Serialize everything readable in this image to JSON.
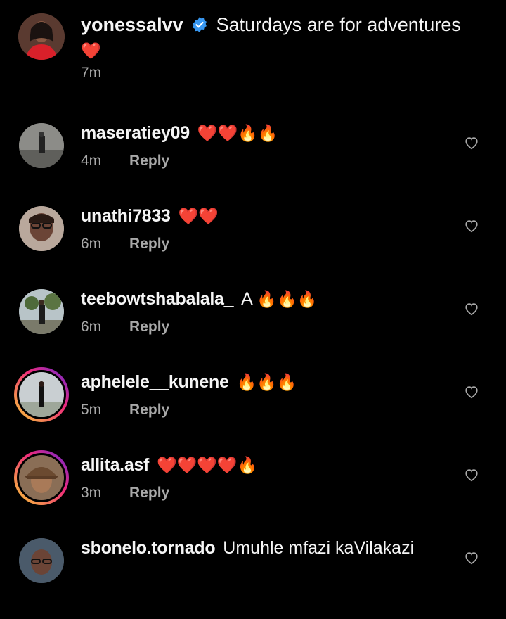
{
  "caption": {
    "username": "yonessalvv",
    "text": "Saturdays are for adventures",
    "emoji": "❤️",
    "time": "7m"
  },
  "comments": [
    {
      "username": "maseratiey09",
      "text": "",
      "emoji": "❤️❤️🔥🔥",
      "time": "4m",
      "reply": "Reply",
      "story_ring": false
    },
    {
      "username": "unathi7833",
      "text": "",
      "emoji": "❤️❤️",
      "time": "6m",
      "reply": "Reply",
      "story_ring": false
    },
    {
      "username": "teebowtshabalala_",
      "text": "A",
      "emoji": "🔥🔥🔥",
      "time": "6m",
      "reply": "Reply",
      "story_ring": false
    },
    {
      "username": "aphelele__kunene",
      "text": "",
      "emoji": "🔥🔥🔥",
      "time": "5m",
      "reply": "Reply",
      "story_ring": true
    },
    {
      "username": "allita.asf",
      "text": "",
      "emoji": "❤️❤️❤️❤️🔥",
      "time": "3m",
      "reply": "Reply",
      "story_ring": true
    },
    {
      "username": "sbonelo.tornado",
      "text": "Umuhle mfazi kaVilakazi",
      "emoji": "",
      "time": "",
      "reply": "",
      "story_ring": false
    }
  ],
  "colors": {
    "background": "#000000",
    "text": "#f5f5f5",
    "muted": "#a8a8a8",
    "verified": "#3897f0"
  }
}
